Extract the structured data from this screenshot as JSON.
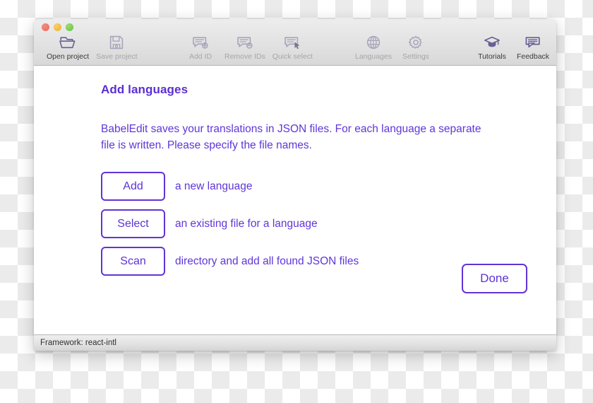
{
  "window": {
    "traffic_lights": [
      {
        "name": "close",
        "color": "#e8675c"
      },
      {
        "name": "minimize",
        "color": "#e9b12c"
      },
      {
        "name": "zoom",
        "color": "#64c04a"
      }
    ]
  },
  "toolbar": {
    "groups": [
      {
        "name": "project",
        "items": [
          {
            "label": "Open project",
            "icon": "open-folder-icon",
            "enabled": true
          },
          {
            "label": "Save project",
            "icon": "floppy-disk-icon",
            "enabled": false
          }
        ]
      },
      {
        "name": "ids",
        "items": [
          {
            "label": "Add ID",
            "icon": "speech-bubble-plus-icon",
            "enabled": false
          },
          {
            "label": "Remove IDs",
            "icon": "speech-bubble-minus-icon",
            "enabled": false
          },
          {
            "label": "Quick select",
            "icon": "speech-bubble-cursor-icon",
            "enabled": false
          }
        ]
      },
      {
        "name": "settings",
        "items": [
          {
            "label": "Languages",
            "icon": "globe-icon",
            "enabled": false
          },
          {
            "label": "Settings",
            "icon": "gear-icon",
            "enabled": false
          }
        ]
      },
      {
        "name": "help",
        "items": [
          {
            "label": "Tutorials",
            "icon": "graduation-cap-icon",
            "enabled": true
          },
          {
            "label": "Feedback",
            "icon": "speech-bubble-lines-icon",
            "enabled": true
          }
        ]
      }
    ]
  },
  "main": {
    "title": "Add languages",
    "intro": "BabelEdit saves your translations in JSON files. For each language a separate file is written. Please specify the file names.",
    "rows": [
      {
        "button": "Add",
        "description": "a new language"
      },
      {
        "button": "Select",
        "description": "an existing file for a language"
      },
      {
        "button": "Scan",
        "description": "directory and add all found JSON files"
      }
    ],
    "done_label": "Done"
  },
  "statusbar": {
    "text": "Framework: react-intl"
  },
  "colors": {
    "accent": "#5d33d6",
    "heading": "#5a2fd4",
    "body_text": "#5f36d8",
    "toolbar_icon_active": "#6a5e96",
    "toolbar_icon_dim": "#a9a4bb"
  }
}
